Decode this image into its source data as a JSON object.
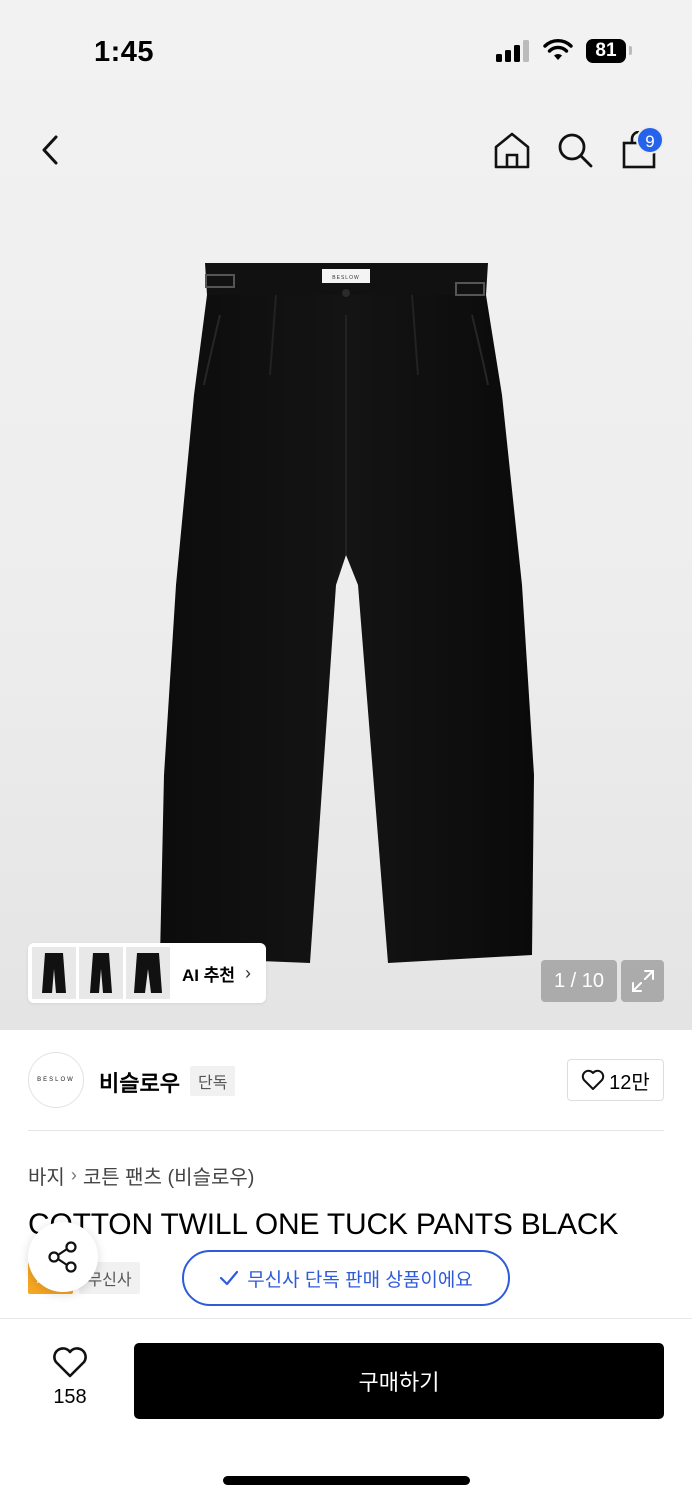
{
  "status_bar": {
    "time": "1:45",
    "battery": "81"
  },
  "navbar": {
    "cart_count": "9"
  },
  "gallery": {
    "ai_label": "AI 추천",
    "counter": "1 / 10",
    "brand_print": "BESLOW"
  },
  "brand": {
    "logo_text": "BESLOW",
    "name": "비슬로우",
    "exclusive_label": "단독",
    "like_count": "12만"
  },
  "breadcrumb": [
    "바지",
    "코튼 팬츠 (비슬로우)"
  ],
  "product": {
    "title": "COTTON TWILL ONE TUCK PANTS BLACK",
    "tags": [
      "세일",
      "무신사"
    ]
  },
  "toast": {
    "text": "무신사 단독 판매 상품이에요"
  },
  "bottom_bar": {
    "wish_count": "158",
    "buy_label": "구매하기"
  },
  "colors": {
    "accent_blue": "#2f5bd9",
    "badge_blue": "#2563eb",
    "sale_orange": "#f5a623"
  }
}
